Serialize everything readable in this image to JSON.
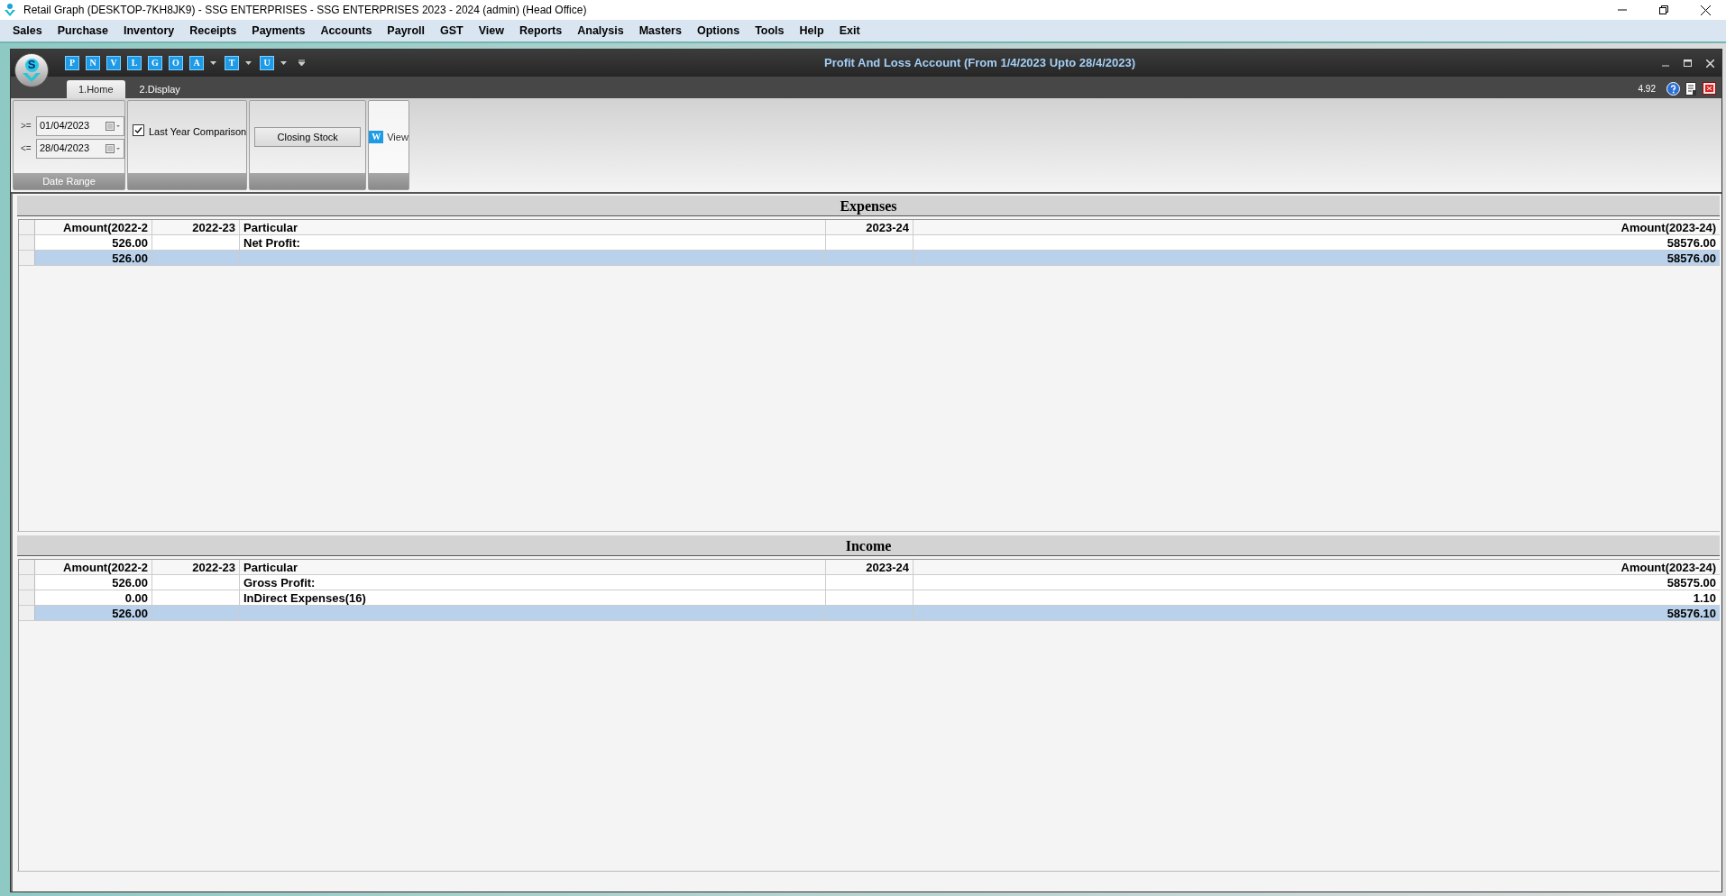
{
  "window": {
    "title": "Retail Graph (DESKTOP-7KH8JK9) - SSG ENTERPRISES - SSG ENTERPRISES  2023 - 2024 (admin) (Head Office)"
  },
  "menu": [
    "Sales",
    "Purchase",
    "Inventory",
    "Receipts",
    "Payments",
    "Accounts",
    "Payroll",
    "GST",
    "View",
    "Reports",
    "Analysis",
    "Masters",
    "Options",
    "Tools",
    "Help",
    "Exit"
  ],
  "document": {
    "title": "Profit And Loss Account (From 1/4/2023 Upto 28/4/2023)",
    "version": "4.92",
    "logo_letter": "S"
  },
  "quick_access": [
    {
      "letter": "P",
      "dropdown": false
    },
    {
      "letter": "N",
      "dropdown": false
    },
    {
      "letter": "V",
      "dropdown": false
    },
    {
      "letter": "L",
      "dropdown": false
    },
    {
      "letter": "G",
      "dropdown": false
    },
    {
      "letter": "O",
      "dropdown": false
    },
    {
      "letter": "A",
      "dropdown": true
    },
    {
      "letter": "T",
      "dropdown": true
    },
    {
      "letter": "U",
      "dropdown": true
    }
  ],
  "tabs": [
    {
      "label": "1.Home",
      "selected": true
    },
    {
      "label": "2.Display",
      "selected": false
    }
  ],
  "ribbon": {
    "date_range": {
      "caption": "Date Range",
      "fields": [
        {
          "operator": ">=",
          "value": "01/04/2023"
        },
        {
          "operator": "<=",
          "value": "28/04/2023"
        }
      ]
    },
    "last_year_comparison": {
      "label": "Last Year Comparison",
      "checked": true
    },
    "closing_stock": {
      "label": "Closing Stock"
    },
    "view": {
      "label": "View",
      "icon_letter": "W"
    }
  },
  "sections": [
    {
      "title": "Expenses",
      "columns": [
        "Amount(2022-2",
        "2022-23",
        "Particular",
        "2023-24",
        "Amount(2023-24)"
      ],
      "rows": [
        {
          "kind": "item",
          "cells": [
            "526.00",
            "",
            "Net Profit:",
            "",
            "58576.00"
          ]
        },
        {
          "kind": "total",
          "cells": [
            "526.00",
            "",
            "",
            "",
            "58576.00"
          ]
        }
      ]
    },
    {
      "title": "Income",
      "columns": [
        "Amount(2022-2",
        "2022-23",
        "Particular",
        "2023-24",
        "Amount(2023-24)"
      ],
      "rows": [
        {
          "kind": "item",
          "cells": [
            "526.00",
            "",
            "Gross Profit:",
            "",
            "58575.00"
          ]
        },
        {
          "kind": "item",
          "cells": [
            "0.00",
            "",
            "InDirect Expenses(16)",
            "",
            "1.10"
          ]
        },
        {
          "kind": "total",
          "cells": [
            "526.00",
            "",
            "",
            "",
            "58576.10"
          ]
        }
      ]
    }
  ]
}
